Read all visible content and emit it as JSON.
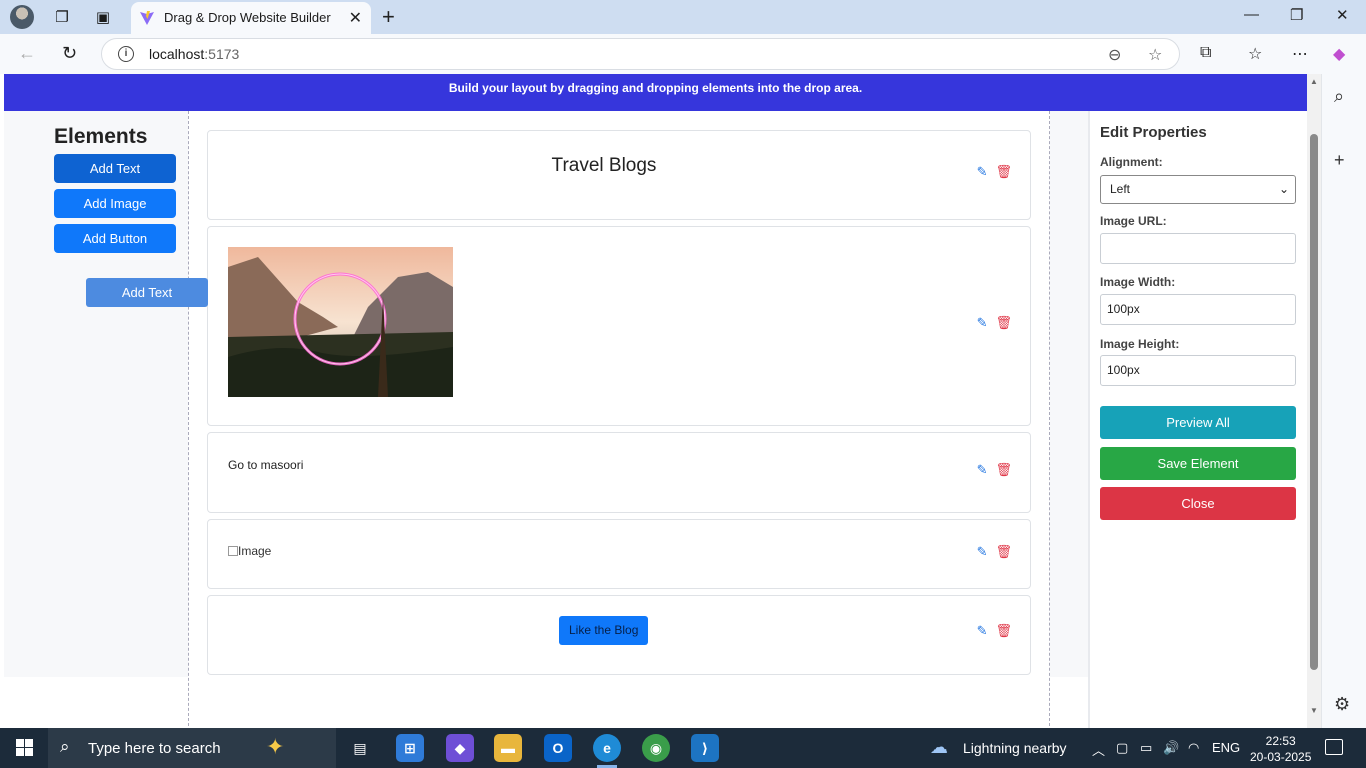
{
  "browser": {
    "tab_title": "Drag & Drop Website Builder",
    "url_host": "localhost",
    "url_port": ":5173",
    "new_tab_symbol": "+",
    "close_tab_symbol": "✕"
  },
  "banner": {
    "text": "Build your layout by dragging and dropping elements into the drop area."
  },
  "elements_panel": {
    "title": "Elements",
    "buttons": [
      "Add Text",
      "Add Image",
      "Add Button"
    ],
    "drag_ghost": "Add Text"
  },
  "canvas": {
    "heading": "Travel Blogs",
    "text_block": "Go to masoori",
    "broken_image_alt": "Image",
    "blog_button": "Like the Blog"
  },
  "properties": {
    "title": "Edit Properties",
    "alignment_label": "Alignment:",
    "alignment_value": "Left",
    "image_url_label": "Image URL:",
    "image_url_value": "",
    "image_width_label": "Image Width:",
    "image_width_value": "100px",
    "image_height_label": "Image Height:",
    "image_height_value": "100px",
    "preview_button": "Preview All",
    "save_button": "Save Element",
    "close_button": "Close"
  },
  "colors": {
    "banner": "#3636dc",
    "primary": "#0f78fa",
    "preview": "#17a2b8",
    "save": "#28a745",
    "close": "#dc3545"
  },
  "taskbar": {
    "search_placeholder": "Type here to search",
    "weather": "Lightning nearby",
    "language": "ENG",
    "time": "22:53",
    "date": "20-03-2025"
  }
}
